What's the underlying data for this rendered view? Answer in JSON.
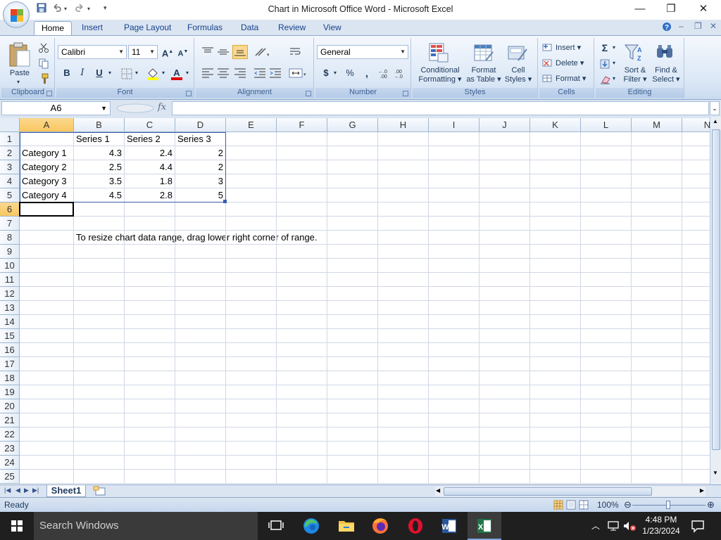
{
  "window": {
    "title": "Chart in Microsoft Office Word - Microsoft Excel",
    "minimize_glyph": "—",
    "maximize_glyph": "❐",
    "close_glyph": "✕"
  },
  "qat": {
    "customize_glyph": "▾"
  },
  "tabs": [
    {
      "label": "Home",
      "active": true
    },
    {
      "label": "Insert"
    },
    {
      "label": "Page Layout"
    },
    {
      "label": "Formulas"
    },
    {
      "label": "Data"
    },
    {
      "label": "Review"
    },
    {
      "label": "View"
    }
  ],
  "ribbon": {
    "clipboard": {
      "paste": "Paste",
      "label": "Clipboard"
    },
    "font": {
      "name": "Calibri",
      "size": "11",
      "bold": "B",
      "italic": "I",
      "underline": "U",
      "label": "Font"
    },
    "alignment": {
      "label": "Alignment"
    },
    "number": {
      "format": "General",
      "currency": "$",
      "percent": "%",
      "comma": ",",
      "label": "Number"
    },
    "styles": {
      "conditional_line1": "Conditional",
      "conditional_line2": "Formatting ▾",
      "format_table_line1": "Format",
      "format_table_line2": "as Table ▾",
      "cell_styles_line1": "Cell",
      "cell_styles_line2": "Styles ▾",
      "label": "Styles"
    },
    "cells": {
      "insert": "Insert ▾",
      "delete": "Delete ▾",
      "format": "Format ▾",
      "label": "Cells"
    },
    "editing": {
      "sum_glyph": "Σ",
      "sort_line1": "Sort &",
      "sort_line2": "Filter ▾",
      "find_line1": "Find &",
      "find_line2": "Select ▾",
      "label": "Editing"
    }
  },
  "formula_bar": {
    "name_box": "A6",
    "fx": "fx",
    "value": ""
  },
  "sheet": {
    "columns": [
      "A",
      "B",
      "C",
      "D",
      "E",
      "F",
      "G",
      "H",
      "I",
      "J",
      "K",
      "L",
      "M",
      "N"
    ],
    "rows": [
      "1",
      "2",
      "3",
      "4",
      "5",
      "6",
      "7",
      "8",
      "9",
      "10",
      "11",
      "12",
      "13",
      "14",
      "15",
      "16",
      "17",
      "18",
      "19",
      "20",
      "21",
      "22",
      "23",
      "24",
      "25"
    ],
    "cells": {
      "B1": "Series 1",
      "C1": "Series 2",
      "D1": "Series 3",
      "A2": "Category 1",
      "B2": "4.3",
      "C2": "2.4",
      "D2": "2",
      "A3": "Category 2",
      "B3": "2.5",
      "C3": "4.4",
      "D3": "2",
      "A4": "Category 3",
      "B4": "3.5",
      "C4": "1.8",
      "D4": "3",
      "A5": "Category 4",
      "B5": "4.5",
      "C5": "2.8",
      "D5": "5",
      "B8": "To resize chart data range, drag lower right corner of range."
    },
    "active_cell": "A6",
    "sheet_tab": "Sheet1"
  },
  "status": {
    "text": "Ready",
    "zoom": "100%"
  },
  "taskbar": {
    "search_placeholder": "Search Windows",
    "time": "4:48 PM",
    "date": "1/23/2024"
  }
}
